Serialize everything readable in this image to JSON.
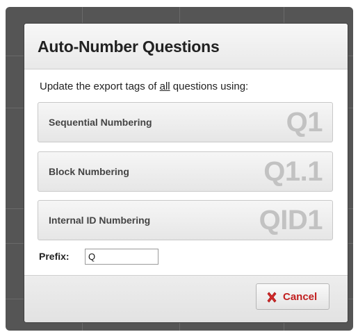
{
  "dialog": {
    "title": "Auto-Number Questions",
    "instruction": {
      "before": "Update the export tags of ",
      "emphasis": "all",
      "after": " questions using:"
    },
    "options": [
      {
        "label": "Sequential Numbering",
        "tag": "Q1"
      },
      {
        "label": "Block Numbering",
        "tag": "Q1.1"
      },
      {
        "label": "Internal ID Numbering",
        "tag": "QID1"
      }
    ],
    "prefix": {
      "label": "Prefix:",
      "value": "Q"
    },
    "footer": {
      "cancel_label": "Cancel",
      "cancel_icon": "x-icon",
      "cancel_color": "#c22020"
    }
  }
}
